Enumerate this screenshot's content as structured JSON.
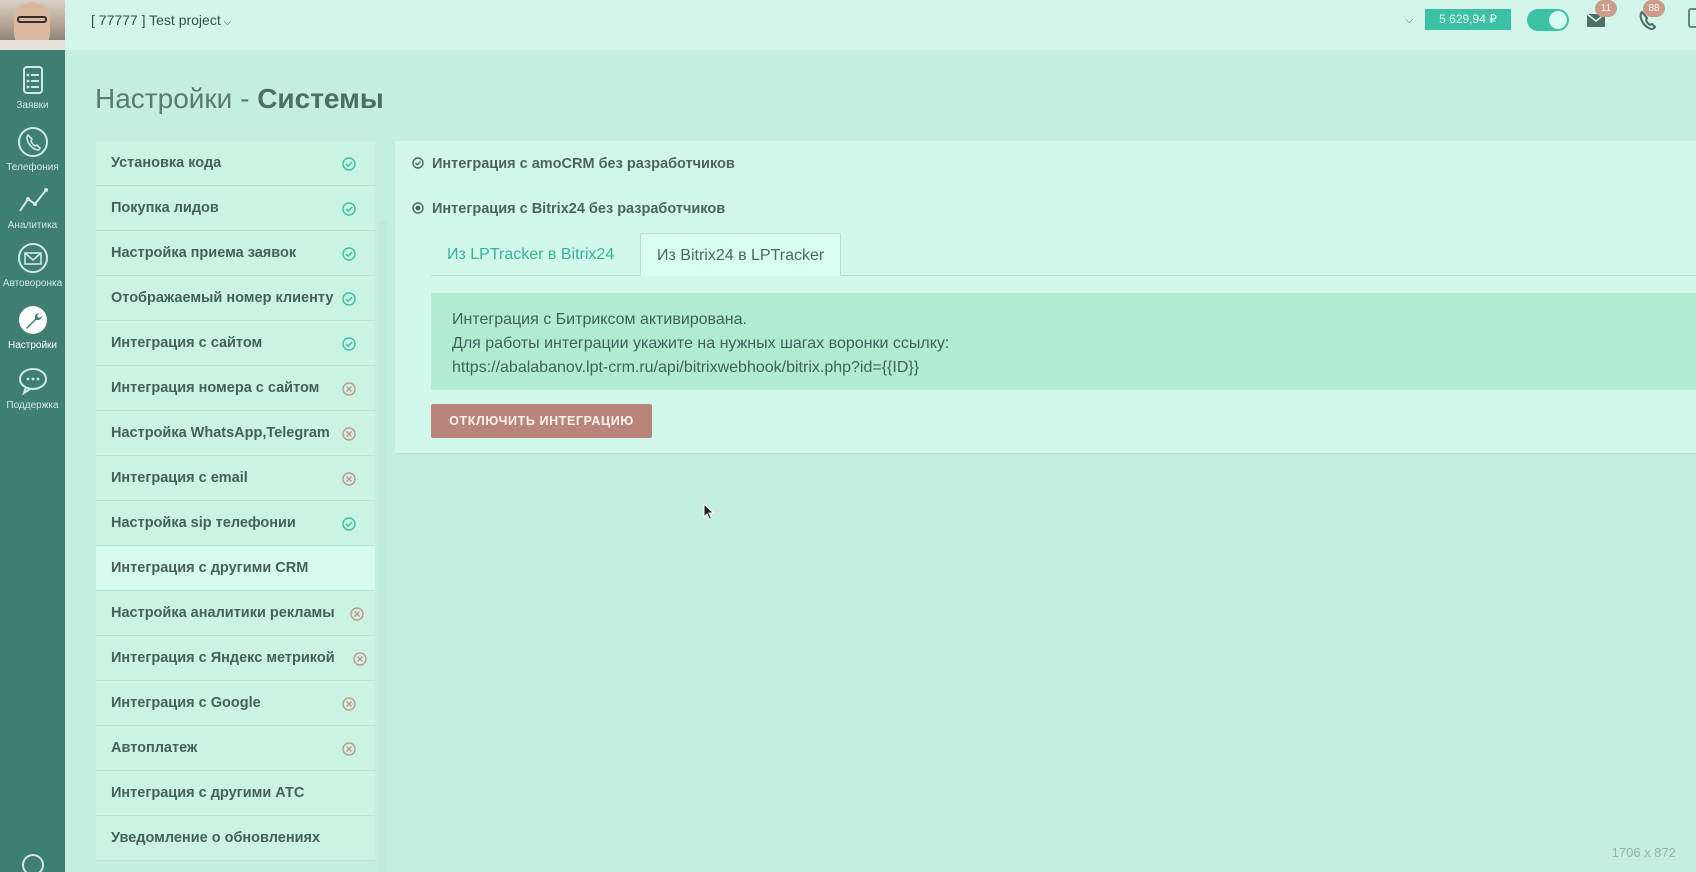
{
  "rail": {
    "items": [
      {
        "label": "Заявки",
        "icon": "clipboard-list-icon"
      },
      {
        "label": "Телефония",
        "icon": "phone-icon"
      },
      {
        "label": "Аналитика",
        "icon": "analytics-chart-icon"
      },
      {
        "label": "Автоворонка",
        "icon": "envelope-icon"
      },
      {
        "label": "Настройки",
        "icon": "wrench-icon",
        "active": true
      },
      {
        "label": "Поддержка",
        "icon": "chat-bubble-icon"
      }
    ]
  },
  "topbar": {
    "project": "[ 77777 ] Test project",
    "balance": "5 629,94 ₽",
    "mail_count": "11",
    "calls_count": "88"
  },
  "page": {
    "title_prefix": "Настройки - ",
    "title_bold": "Системы"
  },
  "menu": {
    "items": [
      {
        "label": "Установка кода",
        "state": "ok"
      },
      {
        "label": "Покупка лидов",
        "state": "ok"
      },
      {
        "label": "Настройка приема заявок",
        "state": "ok"
      },
      {
        "label": "Отображаемый номер клиенту",
        "state": "ok"
      },
      {
        "label": "Интеграция с сайтом",
        "state": "ok"
      },
      {
        "label": "Интеграция номера с сайтом",
        "state": "off"
      },
      {
        "label": "Настройка WhatsApp,Telegram",
        "state": "off"
      },
      {
        "label": "Интеграция с email",
        "state": "off"
      },
      {
        "label": "Настройка sip телефонии",
        "state": "ok"
      },
      {
        "label": "Интеграция с другими CRM",
        "state": "none",
        "active": true
      },
      {
        "label": "Настройка аналитики рекламы",
        "state": "off"
      },
      {
        "label": "Интеграция с Яндекс метрикой",
        "state": "off"
      },
      {
        "label": "Интеграция с Google",
        "state": "off"
      },
      {
        "label": "Автоплатеж",
        "state": "off"
      },
      {
        "label": "Интеграция с другими АТС",
        "state": "none"
      },
      {
        "label": "Уведомление о обновлениях",
        "state": "none"
      }
    ]
  },
  "main": {
    "accordion": [
      {
        "label": "Интеграция с amoCRM без разработчиков"
      },
      {
        "label": "Интеграция с Bitrix24 без разработчиков"
      }
    ],
    "tabs": [
      {
        "label": "Из LPTracker в Bitrix24"
      },
      {
        "label": "Из Bitrix24 в LPTracker",
        "active": true
      }
    ],
    "alert": {
      "line1": "Интеграция с Битриксом активирована.",
      "line2": "Для работы интеграции укажите на нужных шагах воронки ссылку:",
      "line3": "https://abalabanov.lpt-crm.ru/api/bitrixwebhook/bitrix.php?id={{ID}}"
    },
    "disable_button": "ОТКЛЮЧИТЬ ИНТЕГРАЦИЮ"
  },
  "overlay": {
    "dimensions": "1706 x 872"
  },
  "colors": {
    "accent": "#3cc1a4",
    "rail": "#3f7f72",
    "danger_button": "#b9847a",
    "ok_icon": "#3cc1a4",
    "off_icon": "#c2978b"
  }
}
